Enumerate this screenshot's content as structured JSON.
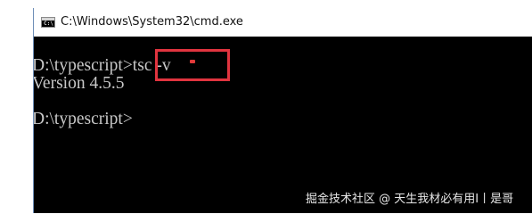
{
  "window": {
    "title": "C:\\Windows\\System32\\cmd.exe",
    "icon": "cmd-icon",
    "icon_text": "C:\\"
  },
  "console": {
    "lines": [
      "D:\\typescript>tsc -v",
      "Version 4.5.5",
      "D:\\typescript>"
    ]
  },
  "annotation": {
    "box_color": "#e0343f"
  },
  "watermark": {
    "text": "掘金技术社区 @ 天生我材必有用I丨是哥"
  }
}
